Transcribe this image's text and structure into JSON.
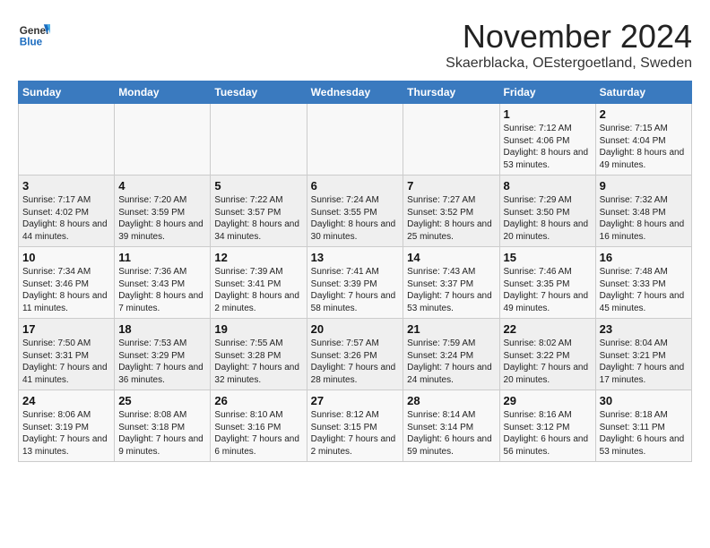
{
  "header": {
    "logo_general": "General",
    "logo_blue": "Blue",
    "month_title": "November 2024",
    "location": "Skaerblacka, OEstergoetland, Sweden"
  },
  "weekdays": [
    "Sunday",
    "Monday",
    "Tuesday",
    "Wednesday",
    "Thursday",
    "Friday",
    "Saturday"
  ],
  "weeks": [
    [
      {
        "day": "",
        "info": ""
      },
      {
        "day": "",
        "info": ""
      },
      {
        "day": "",
        "info": ""
      },
      {
        "day": "",
        "info": ""
      },
      {
        "day": "",
        "info": ""
      },
      {
        "day": "1",
        "info": "Sunrise: 7:12 AM\nSunset: 4:06 PM\nDaylight: 8 hours and 53 minutes."
      },
      {
        "day": "2",
        "info": "Sunrise: 7:15 AM\nSunset: 4:04 PM\nDaylight: 8 hours and 49 minutes."
      }
    ],
    [
      {
        "day": "3",
        "info": "Sunrise: 7:17 AM\nSunset: 4:02 PM\nDaylight: 8 hours and 44 minutes."
      },
      {
        "day": "4",
        "info": "Sunrise: 7:20 AM\nSunset: 3:59 PM\nDaylight: 8 hours and 39 minutes."
      },
      {
        "day": "5",
        "info": "Sunrise: 7:22 AM\nSunset: 3:57 PM\nDaylight: 8 hours and 34 minutes."
      },
      {
        "day": "6",
        "info": "Sunrise: 7:24 AM\nSunset: 3:55 PM\nDaylight: 8 hours and 30 minutes."
      },
      {
        "day": "7",
        "info": "Sunrise: 7:27 AM\nSunset: 3:52 PM\nDaylight: 8 hours and 25 minutes."
      },
      {
        "day": "8",
        "info": "Sunrise: 7:29 AM\nSunset: 3:50 PM\nDaylight: 8 hours and 20 minutes."
      },
      {
        "day": "9",
        "info": "Sunrise: 7:32 AM\nSunset: 3:48 PM\nDaylight: 8 hours and 16 minutes."
      }
    ],
    [
      {
        "day": "10",
        "info": "Sunrise: 7:34 AM\nSunset: 3:46 PM\nDaylight: 8 hours and 11 minutes."
      },
      {
        "day": "11",
        "info": "Sunrise: 7:36 AM\nSunset: 3:43 PM\nDaylight: 8 hours and 7 minutes."
      },
      {
        "day": "12",
        "info": "Sunrise: 7:39 AM\nSunset: 3:41 PM\nDaylight: 8 hours and 2 minutes."
      },
      {
        "day": "13",
        "info": "Sunrise: 7:41 AM\nSunset: 3:39 PM\nDaylight: 7 hours and 58 minutes."
      },
      {
        "day": "14",
        "info": "Sunrise: 7:43 AM\nSunset: 3:37 PM\nDaylight: 7 hours and 53 minutes."
      },
      {
        "day": "15",
        "info": "Sunrise: 7:46 AM\nSunset: 3:35 PM\nDaylight: 7 hours and 49 minutes."
      },
      {
        "day": "16",
        "info": "Sunrise: 7:48 AM\nSunset: 3:33 PM\nDaylight: 7 hours and 45 minutes."
      }
    ],
    [
      {
        "day": "17",
        "info": "Sunrise: 7:50 AM\nSunset: 3:31 PM\nDaylight: 7 hours and 41 minutes."
      },
      {
        "day": "18",
        "info": "Sunrise: 7:53 AM\nSunset: 3:29 PM\nDaylight: 7 hours and 36 minutes."
      },
      {
        "day": "19",
        "info": "Sunrise: 7:55 AM\nSunset: 3:28 PM\nDaylight: 7 hours and 32 minutes."
      },
      {
        "day": "20",
        "info": "Sunrise: 7:57 AM\nSunset: 3:26 PM\nDaylight: 7 hours and 28 minutes."
      },
      {
        "day": "21",
        "info": "Sunrise: 7:59 AM\nSunset: 3:24 PM\nDaylight: 7 hours and 24 minutes."
      },
      {
        "day": "22",
        "info": "Sunrise: 8:02 AM\nSunset: 3:22 PM\nDaylight: 7 hours and 20 minutes."
      },
      {
        "day": "23",
        "info": "Sunrise: 8:04 AM\nSunset: 3:21 PM\nDaylight: 7 hours and 17 minutes."
      }
    ],
    [
      {
        "day": "24",
        "info": "Sunrise: 8:06 AM\nSunset: 3:19 PM\nDaylight: 7 hours and 13 minutes."
      },
      {
        "day": "25",
        "info": "Sunrise: 8:08 AM\nSunset: 3:18 PM\nDaylight: 7 hours and 9 minutes."
      },
      {
        "day": "26",
        "info": "Sunrise: 8:10 AM\nSunset: 3:16 PM\nDaylight: 7 hours and 6 minutes."
      },
      {
        "day": "27",
        "info": "Sunrise: 8:12 AM\nSunset: 3:15 PM\nDaylight: 7 hours and 2 minutes."
      },
      {
        "day": "28",
        "info": "Sunrise: 8:14 AM\nSunset: 3:14 PM\nDaylight: 6 hours and 59 minutes."
      },
      {
        "day": "29",
        "info": "Sunrise: 8:16 AM\nSunset: 3:12 PM\nDaylight: 6 hours and 56 minutes."
      },
      {
        "day": "30",
        "info": "Sunrise: 8:18 AM\nSunset: 3:11 PM\nDaylight: 6 hours and 53 minutes."
      }
    ]
  ]
}
